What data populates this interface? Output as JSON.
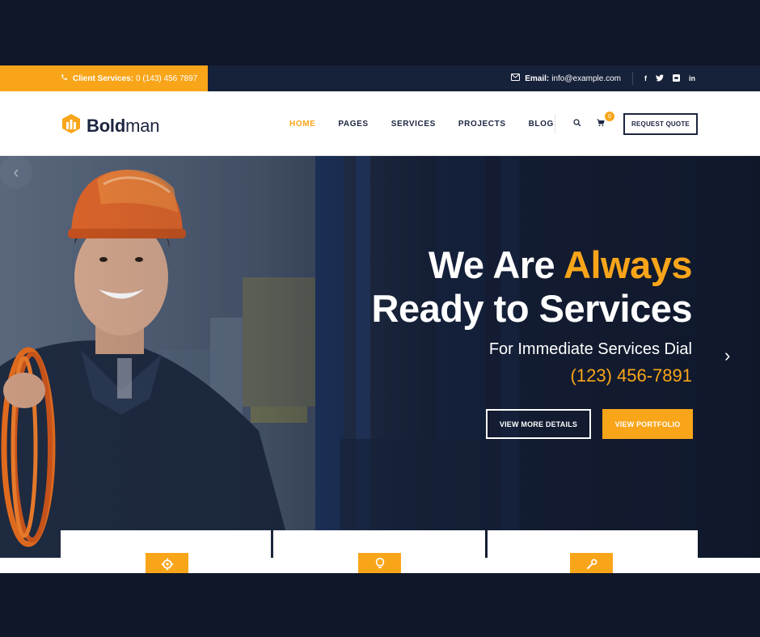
{
  "topbar": {
    "client_label": "Client Services:",
    "client_phone": "0 (143) 456 7897",
    "email_label": "Email:",
    "email_value": "info@example.com",
    "social": [
      "f",
      "t",
      "g",
      "in"
    ]
  },
  "header": {
    "logo_bold": "Bold",
    "logo_light": "man",
    "nav": [
      "HOME",
      "PAGES",
      "SERVICES",
      "PROJECTS",
      "BLOG"
    ],
    "active_nav": "HOME",
    "cart_count": "0",
    "quote_label": "REQUEST QUOTE"
  },
  "hero": {
    "title_line1_plain": "We Are ",
    "title_line1_accent": "Always",
    "title_line2": "Ready to Services",
    "subtitle": "For Immediate Services Dial",
    "phone": "(123) 456-7891",
    "btn_details": "VIEW MORE DETAILS",
    "btn_portfolio": "VIEW PORTFOLIO",
    "prev_arrow": "‹",
    "next_arrow": "›"
  },
  "colors": {
    "accent": "#f9a51a",
    "dark": "#1c2541",
    "frame": "#0f1729"
  },
  "icons": [
    "phone-icon",
    "mail-icon",
    "facebook-icon",
    "twitter-icon",
    "google-plus-icon",
    "linkedin-icon",
    "logo-icon",
    "search-icon",
    "cart-icon",
    "gear-icon",
    "bulb-icon",
    "wrench-icon"
  ]
}
